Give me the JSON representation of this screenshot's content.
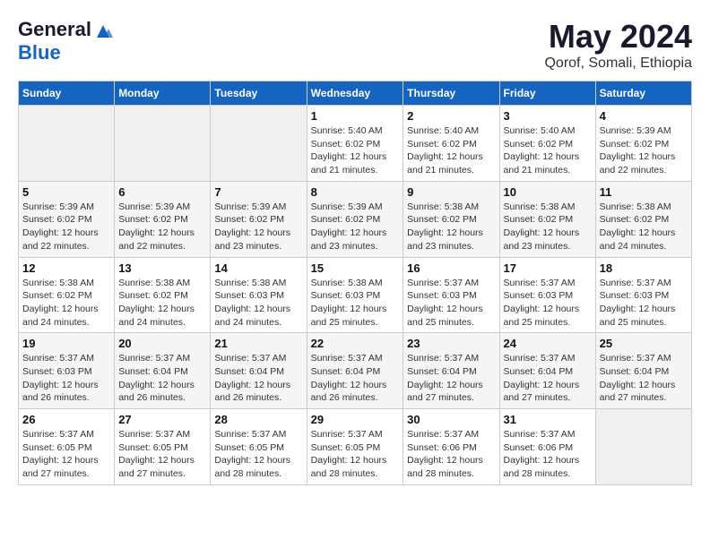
{
  "header": {
    "logo_general": "General",
    "logo_blue": "Blue",
    "month": "May 2024",
    "location": "Qorof, Somali, Ethiopia"
  },
  "weekdays": [
    "Sunday",
    "Monday",
    "Tuesday",
    "Wednesday",
    "Thursday",
    "Friday",
    "Saturday"
  ],
  "weeks": [
    [
      {
        "day": "",
        "info": ""
      },
      {
        "day": "",
        "info": ""
      },
      {
        "day": "",
        "info": ""
      },
      {
        "day": "1",
        "info": "Sunrise: 5:40 AM\nSunset: 6:02 PM\nDaylight: 12 hours and 21 minutes."
      },
      {
        "day": "2",
        "info": "Sunrise: 5:40 AM\nSunset: 6:02 PM\nDaylight: 12 hours and 21 minutes."
      },
      {
        "day": "3",
        "info": "Sunrise: 5:40 AM\nSunset: 6:02 PM\nDaylight: 12 hours and 21 minutes."
      },
      {
        "day": "4",
        "info": "Sunrise: 5:39 AM\nSunset: 6:02 PM\nDaylight: 12 hours and 22 minutes."
      }
    ],
    [
      {
        "day": "5",
        "info": "Sunrise: 5:39 AM\nSunset: 6:02 PM\nDaylight: 12 hours and 22 minutes."
      },
      {
        "day": "6",
        "info": "Sunrise: 5:39 AM\nSunset: 6:02 PM\nDaylight: 12 hours and 22 minutes."
      },
      {
        "day": "7",
        "info": "Sunrise: 5:39 AM\nSunset: 6:02 PM\nDaylight: 12 hours and 23 minutes."
      },
      {
        "day": "8",
        "info": "Sunrise: 5:39 AM\nSunset: 6:02 PM\nDaylight: 12 hours and 23 minutes."
      },
      {
        "day": "9",
        "info": "Sunrise: 5:38 AM\nSunset: 6:02 PM\nDaylight: 12 hours and 23 minutes."
      },
      {
        "day": "10",
        "info": "Sunrise: 5:38 AM\nSunset: 6:02 PM\nDaylight: 12 hours and 23 minutes."
      },
      {
        "day": "11",
        "info": "Sunrise: 5:38 AM\nSunset: 6:02 PM\nDaylight: 12 hours and 24 minutes."
      }
    ],
    [
      {
        "day": "12",
        "info": "Sunrise: 5:38 AM\nSunset: 6:02 PM\nDaylight: 12 hours and 24 minutes."
      },
      {
        "day": "13",
        "info": "Sunrise: 5:38 AM\nSunset: 6:02 PM\nDaylight: 12 hours and 24 minutes."
      },
      {
        "day": "14",
        "info": "Sunrise: 5:38 AM\nSunset: 6:03 PM\nDaylight: 12 hours and 24 minutes."
      },
      {
        "day": "15",
        "info": "Sunrise: 5:38 AM\nSunset: 6:03 PM\nDaylight: 12 hours and 25 minutes."
      },
      {
        "day": "16",
        "info": "Sunrise: 5:37 AM\nSunset: 6:03 PM\nDaylight: 12 hours and 25 minutes."
      },
      {
        "day": "17",
        "info": "Sunrise: 5:37 AM\nSunset: 6:03 PM\nDaylight: 12 hours and 25 minutes."
      },
      {
        "day": "18",
        "info": "Sunrise: 5:37 AM\nSunset: 6:03 PM\nDaylight: 12 hours and 25 minutes."
      }
    ],
    [
      {
        "day": "19",
        "info": "Sunrise: 5:37 AM\nSunset: 6:03 PM\nDaylight: 12 hours and 26 minutes."
      },
      {
        "day": "20",
        "info": "Sunrise: 5:37 AM\nSunset: 6:04 PM\nDaylight: 12 hours and 26 minutes."
      },
      {
        "day": "21",
        "info": "Sunrise: 5:37 AM\nSunset: 6:04 PM\nDaylight: 12 hours and 26 minutes."
      },
      {
        "day": "22",
        "info": "Sunrise: 5:37 AM\nSunset: 6:04 PM\nDaylight: 12 hours and 26 minutes."
      },
      {
        "day": "23",
        "info": "Sunrise: 5:37 AM\nSunset: 6:04 PM\nDaylight: 12 hours and 27 minutes."
      },
      {
        "day": "24",
        "info": "Sunrise: 5:37 AM\nSunset: 6:04 PM\nDaylight: 12 hours and 27 minutes."
      },
      {
        "day": "25",
        "info": "Sunrise: 5:37 AM\nSunset: 6:04 PM\nDaylight: 12 hours and 27 minutes."
      }
    ],
    [
      {
        "day": "26",
        "info": "Sunrise: 5:37 AM\nSunset: 6:05 PM\nDaylight: 12 hours and 27 minutes."
      },
      {
        "day": "27",
        "info": "Sunrise: 5:37 AM\nSunset: 6:05 PM\nDaylight: 12 hours and 27 minutes."
      },
      {
        "day": "28",
        "info": "Sunrise: 5:37 AM\nSunset: 6:05 PM\nDaylight: 12 hours and 28 minutes."
      },
      {
        "day": "29",
        "info": "Sunrise: 5:37 AM\nSunset: 6:05 PM\nDaylight: 12 hours and 28 minutes."
      },
      {
        "day": "30",
        "info": "Sunrise: 5:37 AM\nSunset: 6:06 PM\nDaylight: 12 hours and 28 minutes."
      },
      {
        "day": "31",
        "info": "Sunrise: 5:37 AM\nSunset: 6:06 PM\nDaylight: 12 hours and 28 minutes."
      },
      {
        "day": "",
        "info": ""
      }
    ]
  ]
}
